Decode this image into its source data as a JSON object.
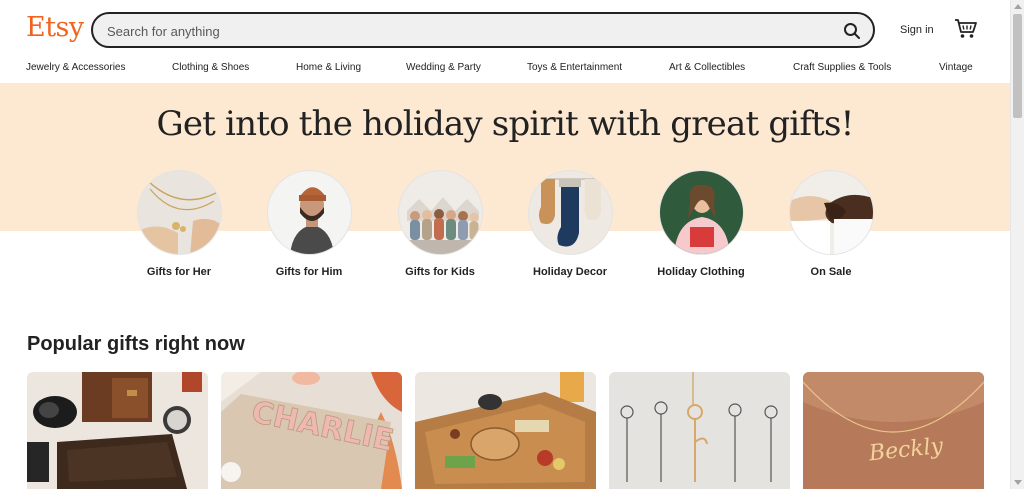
{
  "header": {
    "logo": "Etsy",
    "search_placeholder": "Search for anything",
    "signin_label": "Sign in",
    "icons": {
      "search": "search-icon",
      "cart": "cart-icon"
    },
    "brand_color": "#f1641e"
  },
  "categories": [
    "Jewelry & Accessories",
    "Clothing & Shoes",
    "Home & Living",
    "Wedding & Party",
    "Toys & Entertainment",
    "Art & Collectibles",
    "Craft Supplies & Tools",
    "Vintage"
  ],
  "banner": {
    "headline": "Get into the holiday spirit with great gifts!",
    "background_color": "#fde9d2",
    "items": [
      {
        "label": "Gifts for Her"
      },
      {
        "label": "Gifts for Him"
      },
      {
        "label": "Gifts for Kids"
      },
      {
        "label": "Holiday Decor"
      },
      {
        "label": "Holiday Clothing"
      },
      {
        "label": "On Sale"
      }
    ]
  },
  "popular": {
    "title": "Popular gifts right now",
    "products": [
      {
        "image": "leather wallet and watch set"
      },
      {
        "image": "wooden name puzzle CHARLIE"
      },
      {
        "image": "charcuterie cheese board"
      },
      {
        "image": "birth flower necklace"
      },
      {
        "image": "gold name necklace"
      }
    ]
  }
}
